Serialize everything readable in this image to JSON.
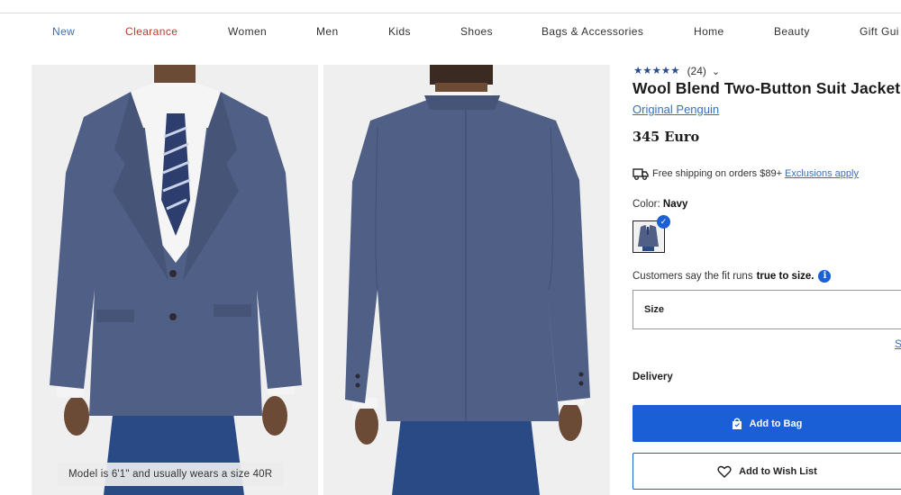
{
  "nav": {
    "items": [
      "New",
      "Clearance",
      "Women",
      "Men",
      "Kids",
      "Shoes",
      "Bags & Accessories",
      "Home",
      "Beauty",
      "Gift Gui"
    ]
  },
  "gallery": {
    "model_caption": "Model is 6'1\" and usually wears a size 40R",
    "jacket_color": "#4f5f86",
    "pants_color": "#2a4a86",
    "background": "#efefef"
  },
  "product": {
    "rating_stars": "★★★★★",
    "rating": 5,
    "review_count": "(24)",
    "title": "Wool Blend Two-Button Suit Jacket",
    "brand": "Original Penguin",
    "price": "345 Euro"
  },
  "shipping": {
    "text": "Free shipping on orders $89+",
    "link": "Exclusions apply"
  },
  "color": {
    "label": "Color:",
    "selected": "Navy"
  },
  "fit": {
    "text": "Customers say the fit runs",
    "bold": "true to size."
  },
  "size": {
    "label": "Size",
    "guide_link": "S"
  },
  "delivery": {
    "label": "Delivery"
  },
  "actions": {
    "add_to_bag": "Add to Bag",
    "add_to_wishlist": "Add to Wish List"
  },
  "colors": {
    "accent": "#1a5fd6",
    "link": "#3a6fb5",
    "clearance": "#c0392b"
  }
}
